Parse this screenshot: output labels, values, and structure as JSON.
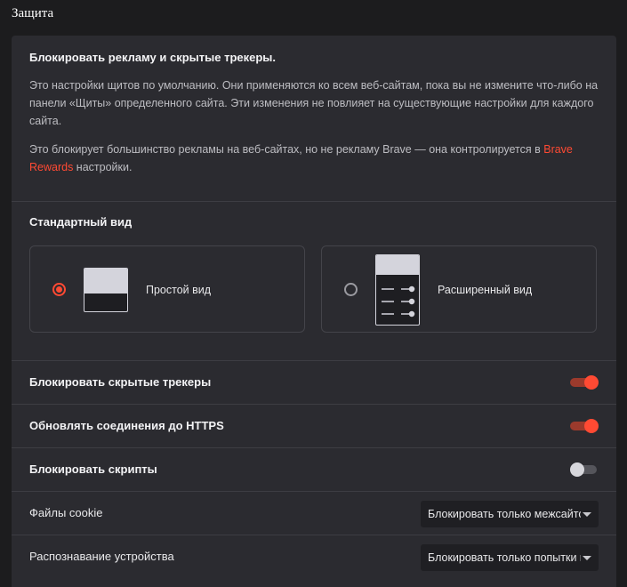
{
  "section_title": "Защита",
  "shields": {
    "title": "Блокировать рекламу и скрытые трекеры.",
    "description": "Это настройки щитов по умолчанию. Они применяются ко всем веб-сайтам, пока вы не измените что-либо на панели «Щиты» определенного сайта. Эти изменения не повлияет на существующие настройки для каждого сайта.",
    "note_prefix": "Это блокирует большинство рекламы на веб-сайтах, но не рекламу Brave — она контролируется в ",
    "note_link": "Brave Rewards",
    "note_suffix": " настройки."
  },
  "view": {
    "title": "Стандартный вид",
    "options": [
      {
        "label": "Простой вид",
        "selected": true
      },
      {
        "label": "Расширенный вид",
        "selected": false
      }
    ]
  },
  "settings": {
    "block_trackers": {
      "label": "Блокировать скрытые трекеры",
      "enabled": true
    },
    "https": {
      "label": "Обновлять соединения до HTTPS",
      "enabled": true
    },
    "scripts": {
      "label": "Блокировать скрипты",
      "enabled": false
    },
    "cookies": {
      "label": "Файлы cookie",
      "value": "Блокировать только межсайтовые"
    },
    "fingerprinting": {
      "label": "Распознавание устройства",
      "value": "Блокировать только попытки межсайтового"
    }
  },
  "colors": {
    "accent": "#ff4a33",
    "background": "#1c1c1e",
    "card": "#2b2b30"
  }
}
